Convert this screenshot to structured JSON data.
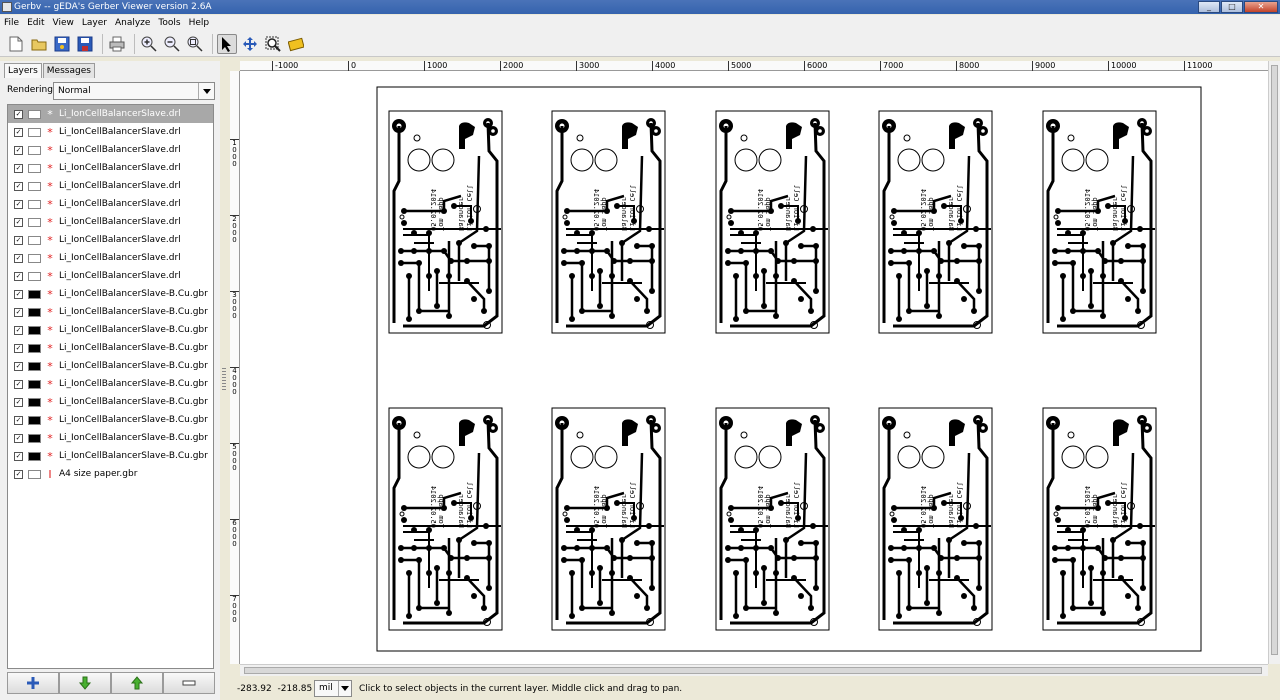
{
  "window": {
    "title": "Gerbv -- gEDA's Gerber Viewer version 2.6A",
    "min": "_",
    "max": "□",
    "close": "✕"
  },
  "menu": [
    "File",
    "Edit",
    "View",
    "Layer",
    "Analyze",
    "Tools",
    "Help"
  ],
  "toolbar": {
    "icons": [
      "new-file-icon",
      "open-icon",
      "revert-icon",
      "save-icon",
      "print-icon",
      "zoom-in-icon",
      "zoom-out-icon",
      "zoom-fit-icon",
      "pointer-icon",
      "pan-icon",
      "zoom-tool-icon",
      "measure-icon"
    ],
    "active": "pointer-icon"
  },
  "sidebar": {
    "tabs": [
      "Layers",
      "Messages"
    ],
    "active_tab": "Layers",
    "rendering_label": "Rendering:",
    "rendering_value": "Normal",
    "layers": [
      {
        "name": "Li_IonCellBalancerSlave.drl",
        "color": "#ffffff",
        "mark": "*",
        "checked": true,
        "selected": true
      },
      {
        "name": "Li_IonCellBalancerSlave.drl",
        "color": "#ffffff",
        "mark": "*",
        "checked": true
      },
      {
        "name": "Li_IonCellBalancerSlave.drl",
        "color": "#ffffff",
        "mark": "*",
        "checked": true
      },
      {
        "name": "Li_IonCellBalancerSlave.drl",
        "color": "#ffffff",
        "mark": "*",
        "checked": true
      },
      {
        "name": "Li_IonCellBalancerSlave.drl",
        "color": "#ffffff",
        "mark": "*",
        "checked": true
      },
      {
        "name": "Li_IonCellBalancerSlave.drl",
        "color": "#ffffff",
        "mark": "*",
        "checked": true
      },
      {
        "name": "Li_IonCellBalancerSlave.drl",
        "color": "#ffffff",
        "mark": "*",
        "checked": true
      },
      {
        "name": "Li_IonCellBalancerSlave.drl",
        "color": "#ffffff",
        "mark": "*",
        "checked": true
      },
      {
        "name": "Li_IonCellBalancerSlave.drl",
        "color": "#ffffff",
        "mark": "*",
        "checked": true
      },
      {
        "name": "Li_IonCellBalancerSlave.drl",
        "color": "#ffffff",
        "mark": "*",
        "checked": true
      },
      {
        "name": "Li_IonCellBalancerSlave-B.Cu.gbr",
        "color": "#000000",
        "mark": "*",
        "checked": true
      },
      {
        "name": "Li_IonCellBalancerSlave-B.Cu.gbr",
        "color": "#000000",
        "mark": "*",
        "checked": true
      },
      {
        "name": "Li_IonCellBalancerSlave-B.Cu.gbr",
        "color": "#000000",
        "mark": "*",
        "checked": true
      },
      {
        "name": "Li_IonCellBalancerSlave-B.Cu.gbr",
        "color": "#000000",
        "mark": "*",
        "checked": true
      },
      {
        "name": "Li_IonCellBalancerSlave-B.Cu.gbr",
        "color": "#000000",
        "mark": "*",
        "checked": true
      },
      {
        "name": "Li_IonCellBalancerSlave-B.Cu.gbr",
        "color": "#000000",
        "mark": "*",
        "checked": true
      },
      {
        "name": "Li_IonCellBalancerSlave-B.Cu.gbr",
        "color": "#000000",
        "mark": "*",
        "checked": true
      },
      {
        "name": "Li_IonCellBalancerSlave-B.Cu.gbr",
        "color": "#000000",
        "mark": "*",
        "checked": true
      },
      {
        "name": "Li_IonCellBalancerSlave-B.Cu.gbr",
        "color": "#000000",
        "mark": "*",
        "checked": true
      },
      {
        "name": "Li_IonCellBalancerSlave-B.Cu.gbr",
        "color": "#000000",
        "mark": "*",
        "checked": true
      },
      {
        "name": "A4 size paper.gbr",
        "color": "#ffffff",
        "mark": "I",
        "checked": true
      }
    ],
    "buttons": [
      "add-layer-icon",
      "move-down-icon",
      "move-up-icon",
      "remove-layer-icon"
    ]
  },
  "ruler": {
    "top": [
      "-1000",
      "0",
      "1000",
      "2000",
      "3000",
      "4000",
      "5000",
      "6000",
      "7000",
      "8000",
      "9000",
      "10000",
      "11000"
    ],
    "left": [
      "1000",
      "2000",
      "3000",
      "4000",
      "5000",
      "6000",
      "7000"
    ]
  },
  "board": {
    "label1": "Li-ion Cell",
    "label2": "Balancer",
    "label3": "Tom Sapp",
    "label4": "05.02.2014"
  },
  "status": {
    "x": "-283.92",
    "y": "-218.85",
    "unit": "mil",
    "message": "Click to select objects in the current layer. Middle click and drag to pan."
  }
}
